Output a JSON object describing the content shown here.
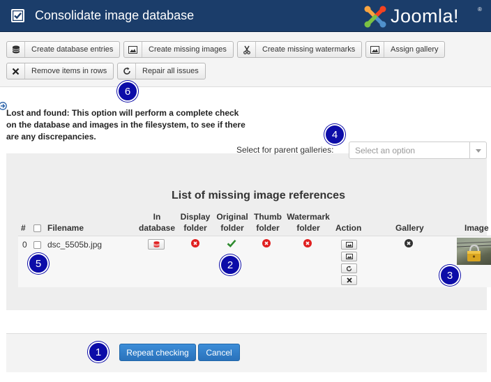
{
  "header": {
    "title": "Consolidate image database",
    "logo_text": "Joomla!",
    "logo_reg": "®"
  },
  "toolbar": {
    "buttons": [
      {
        "label": "Create database entries",
        "icon": "database-icon"
      },
      {
        "label": "Create missing images",
        "icon": "image-icon"
      },
      {
        "label": "Create missing watermarks",
        "icon": "scissors-icon"
      },
      {
        "label": "Assign gallery",
        "icon": "image-icon"
      },
      {
        "label": "Remove items in rows",
        "icon": "close-icon"
      },
      {
        "label": "Repair all issues",
        "icon": "refresh-icon"
      }
    ]
  },
  "description": "Lost and found: This option will perform a complete check on the database and images in the filesystem, to see if there are any discrepancies.",
  "parent_gallery": {
    "label": "Select for parent galleries:",
    "placeholder": "Select an option"
  },
  "list": {
    "title": "List of missing image references",
    "columns": {
      "num": "#",
      "filename": "Filename",
      "in_database_1": "In",
      "in_database_2": "database",
      "display_1": "Display",
      "display_2": "folder",
      "original_1": "Original",
      "original_2": "folder",
      "thumb_1": "Thumb",
      "thumb_2": "folder",
      "watermark_1": "Watermark",
      "watermark_2": "folder",
      "action": "Action",
      "gallery": "Gallery",
      "image": "Image"
    },
    "rows": [
      {
        "num": "0",
        "filename": "dsc_5505b.jpg",
        "in_database": "missing",
        "display_folder": "missing",
        "original_folder": "present",
        "thumb_folder": "missing",
        "watermark_folder": "missing",
        "gallery": "missing"
      }
    ]
  },
  "footer": {
    "repeat_label": "Repeat checking",
    "cancel_label": "Cancel"
  },
  "callouts": [
    "1",
    "2",
    "3",
    "4",
    "5",
    "6"
  ],
  "colors": {
    "header_bg": "#1b3d6a",
    "status_error": "#e02020",
    "status_ok": "#2e8b2e",
    "primary_button": "#2a72bb",
    "callout": "#0c0ca8"
  }
}
